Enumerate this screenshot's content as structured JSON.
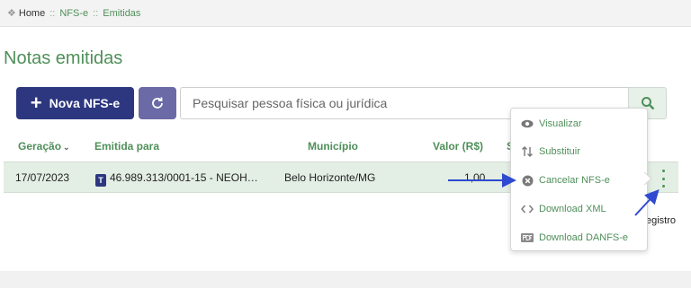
{
  "breadcrumb": {
    "home": "Home",
    "sep": "::",
    "items": [
      "NFS-e",
      "Emitidas"
    ]
  },
  "page_title": "Notas emitidas",
  "toolbar": {
    "new_label": "Nova NFS-e",
    "search_placeholder": "Pesquisar pessoa física ou jurídica"
  },
  "table": {
    "headers": {
      "geracao": "Geração",
      "emitida": "Emitida para",
      "municipio": "Município",
      "valor": "Valor (R$)",
      "partial": "S"
    },
    "row": {
      "date": "17/07/2023",
      "badge": "T",
      "emitida": "46.989.313/0001-15 - NEOH…",
      "municipio": "Belo Horizonte/MG",
      "valor": "1,00"
    }
  },
  "registro_text": "egistro",
  "menu": [
    {
      "label": "Visualizar",
      "icon": "eye-icon"
    },
    {
      "label": "Substituir",
      "icon": "swap-vertical-icon"
    },
    {
      "label": "Cancelar NFS-e",
      "icon": "cancel-circle-icon"
    },
    {
      "label": "Download XML",
      "icon": "code-icon"
    },
    {
      "label": "Download DANFS-e",
      "icon": "pdf-icon"
    }
  ],
  "colors": {
    "brand_green": "#4f8f5a",
    "primary_navy": "#2d3780",
    "refresh_purple": "#6b6aa6",
    "row_highlight": "#e3eee4",
    "annotation_blue": "#2f4ad0"
  }
}
